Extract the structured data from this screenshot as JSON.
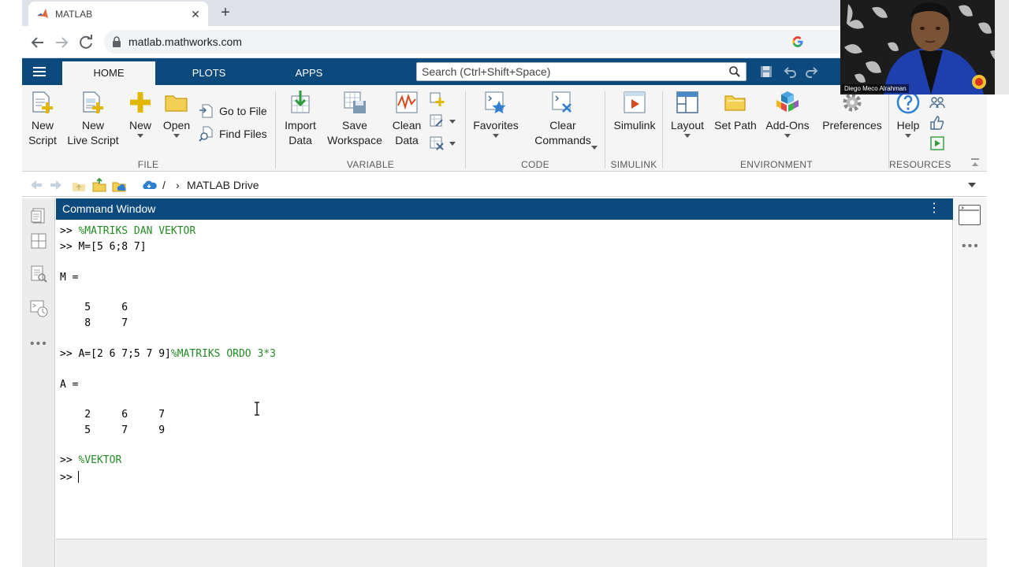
{
  "browser": {
    "tab_title": "MATLAB",
    "tab_close": "✕",
    "new_tab": "+",
    "url": "matlab.mathworks.com"
  },
  "toolstrip": {
    "tabs": [
      {
        "label": "HOME",
        "active": true
      },
      {
        "label": "PLOTS",
        "active": false
      },
      {
        "label": "APPS",
        "active": false
      }
    ],
    "search_placeholder": "Search (Ctrl+Shift+Space)"
  },
  "ribbon": {
    "file": {
      "section_label": "FILE",
      "new_script": "New\nScript",
      "new_live_script": "New\nLive Script",
      "new": "New",
      "open": "Open",
      "go_to_file": "Go to File",
      "find_files": "Find Files"
    },
    "variable": {
      "section_label": "VARIABLE",
      "import_data": "Import\nData",
      "save_workspace": "Save\nWorkspace",
      "clean_data": "Clean\nData"
    },
    "code": {
      "section_label": "CODE",
      "favorites": "Favorites",
      "clear_commands": "Clear\nCommands"
    },
    "simulink": {
      "section_label": "SIMULINK",
      "simulink": "Simulink"
    },
    "environment": {
      "section_label": "ENVIRONMENT",
      "layout": "Layout",
      "set_path": "Set Path",
      "add_ons": "Add-Ons",
      "preferences": "Preferences"
    },
    "resources": {
      "section_label": "RESOURCES",
      "help": "Help"
    }
  },
  "pathbar": {
    "separator": "/",
    "chevron": "›",
    "location": "MATLAB Drive"
  },
  "command_window": {
    "title": "Command Window",
    "menu_icon": "⋮",
    "lines": [
      {
        "prompt": ">> ",
        "code": "",
        "comment": "%MATRIKS DAN VEKTOR"
      },
      {
        "prompt": ">> ",
        "code": "M=[5 6;8 7]",
        "comment": ""
      },
      {
        "prompt": "",
        "code": "M =",
        "comment": ""
      },
      {
        "prompt": "",
        "code": "    5     6",
        "comment": ""
      },
      {
        "prompt": "",
        "code": "    8     7",
        "comment": ""
      },
      {
        "prompt": ">> ",
        "code": "A=[2 6 7;5 7 9]",
        "comment": "%MATRIKS ORDO 3*3"
      },
      {
        "prompt": "",
        "code": "A =",
        "comment": ""
      },
      {
        "prompt": "",
        "code": "    2     6     7",
        "comment": ""
      },
      {
        "prompt": "",
        "code": "    5     7     9",
        "comment": ""
      },
      {
        "prompt": ">> ",
        "code": "",
        "comment": "%VEKTOR"
      },
      {
        "prompt": ">> ",
        "code": "",
        "comment": ""
      }
    ]
  },
  "sidebar": {
    "more": "•••"
  },
  "webcam": {
    "name": "Diego Meco Alrahman"
  },
  "colors": {
    "matlab_blue": "#0c4a7e",
    "comment_green": "#228b22",
    "ribbon_bg": "#f5f5f5"
  }
}
